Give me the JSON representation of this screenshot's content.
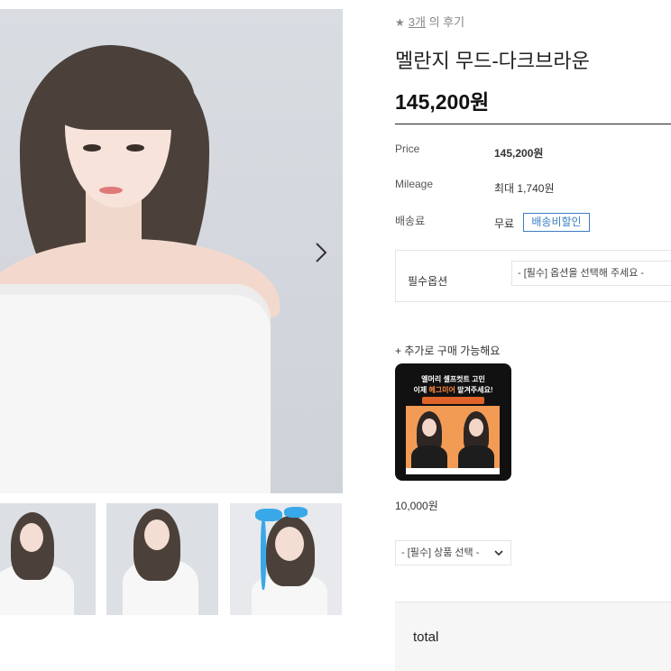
{
  "gallery": {
    "thumbnails": [
      "thumbnail-1",
      "thumbnail-2",
      "thumbnail-3"
    ]
  },
  "review": {
    "star": "★",
    "count": "3개",
    "suffix": "의 후기"
  },
  "product": {
    "name": "멜란지 무드-다크브라운",
    "price": "145,200원"
  },
  "info": {
    "price_label": "Price",
    "price_value": "145,200원",
    "mileage_label": "Mileage",
    "mileage_value": "최대 1,740원",
    "shipping_label": "배송료",
    "shipping_value": "무료",
    "shipping_badge": "배송비할인"
  },
  "options": {
    "label": "필수옵션",
    "placeholder": "- [필수] 옵션을 선택해 주세요 -"
  },
  "addon": {
    "heading": "+ 추가로 구매 가능해요",
    "card_line1": "엘머리 셀프컷트 고민",
    "card_line2_a": "이제 ",
    "card_line2_hl": "헤그미어",
    "card_line2_b": " 맡겨주세요!",
    "price": "10,000원",
    "select_placeholder": "- [필수] 상품 선택 -"
  },
  "total": {
    "label": "total"
  },
  "colors": {
    "accent_blue": "#3b7dc4",
    "addon_orange": "#f29b55"
  }
}
